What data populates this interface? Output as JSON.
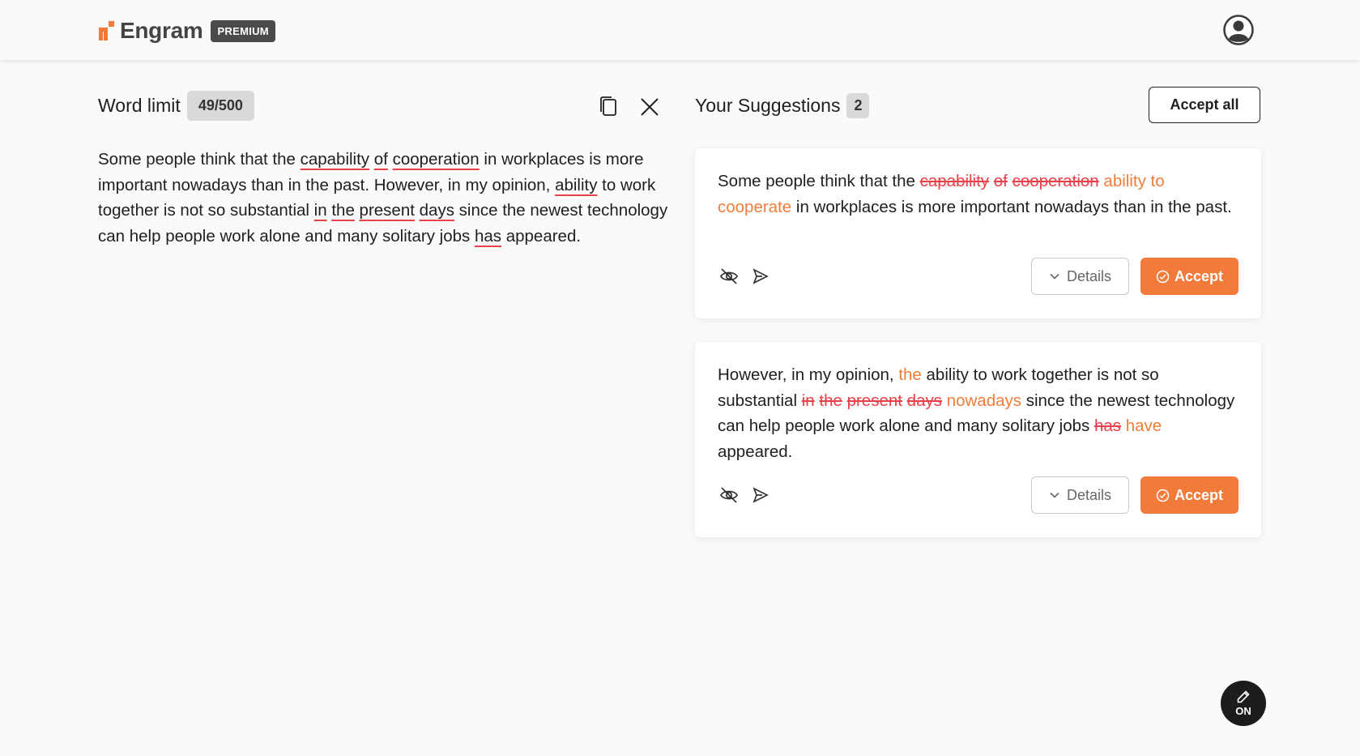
{
  "brand": {
    "name": "Engram",
    "badge": "PREMIUM",
    "accent": "#f27a3a"
  },
  "editor": {
    "word_limit_label": "Word limit",
    "word_count": "49/500",
    "segments": [
      {
        "text": "Some people think that the ",
        "error": false
      },
      {
        "text": "capability",
        "error": true
      },
      {
        "text": " ",
        "error": false
      },
      {
        "text": "of",
        "error": true
      },
      {
        "text": " ",
        "error": false
      },
      {
        "text": "cooperation",
        "error": true
      },
      {
        "text": " in workplaces is more important nowadays than in the past. However, in my opinion, ",
        "error": false
      },
      {
        "text": "ability",
        "error": true
      },
      {
        "text": " to work together is not so substantial ",
        "error": false
      },
      {
        "text": "in",
        "error": true
      },
      {
        "text": " ",
        "error": false
      },
      {
        "text": "the",
        "error": true
      },
      {
        "text": " ",
        "error": false
      },
      {
        "text": "present",
        "error": true
      },
      {
        "text": " ",
        "error": false
      },
      {
        "text": "days",
        "error": true
      },
      {
        "text": " since the newest technology can help people work alone and many solitary jobs ",
        "error": false
      },
      {
        "text": "has",
        "error": true
      },
      {
        "text": " appeared.",
        "error": false
      }
    ]
  },
  "suggestions": {
    "title": "Your Suggestions",
    "count": "2",
    "accept_all_label": "Accept all",
    "details_label": "Details",
    "accept_label": "Accept",
    "items": [
      {
        "segments": [
          {
            "text": "Some people think that the ",
            "type": "plain"
          },
          {
            "text": "capability",
            "type": "del"
          },
          {
            "text": " ",
            "type": "plain"
          },
          {
            "text": "of",
            "type": "del"
          },
          {
            "text": " ",
            "type": "plain"
          },
          {
            "text": "cooperation",
            "type": "del"
          },
          {
            "text": " ",
            "type": "plain"
          },
          {
            "text": "ability to cooperate",
            "type": "ins"
          },
          {
            "text": " in workplaces is more important nowadays than in the past.",
            "type": "plain"
          }
        ]
      },
      {
        "segments": [
          {
            "text": "However, in my opinion, ",
            "type": "plain"
          },
          {
            "text": "the",
            "type": "ins"
          },
          {
            "text": " ability to work together is not so substantial ",
            "type": "plain"
          },
          {
            "text": "in",
            "type": "del"
          },
          {
            "text": " ",
            "type": "plain"
          },
          {
            "text": "the",
            "type": "del"
          },
          {
            "text": " ",
            "type": "plain"
          },
          {
            "text": "present",
            "type": "del"
          },
          {
            "text": " ",
            "type": "plain"
          },
          {
            "text": "days",
            "type": "del"
          },
          {
            "text": " ",
            "type": "plain"
          },
          {
            "text": "nowadays",
            "type": "ins"
          },
          {
            "text": " since the newest technology can help people work alone and many solitary jobs ",
            "type": "plain"
          },
          {
            "text": "has",
            "type": "del"
          },
          {
            "text": " ",
            "type": "plain"
          },
          {
            "text": "have",
            "type": "ins"
          },
          {
            "text": " appeared.",
            "type": "plain"
          }
        ]
      }
    ]
  },
  "fab": {
    "label": "ON",
    "icon": "pencil-icon"
  }
}
